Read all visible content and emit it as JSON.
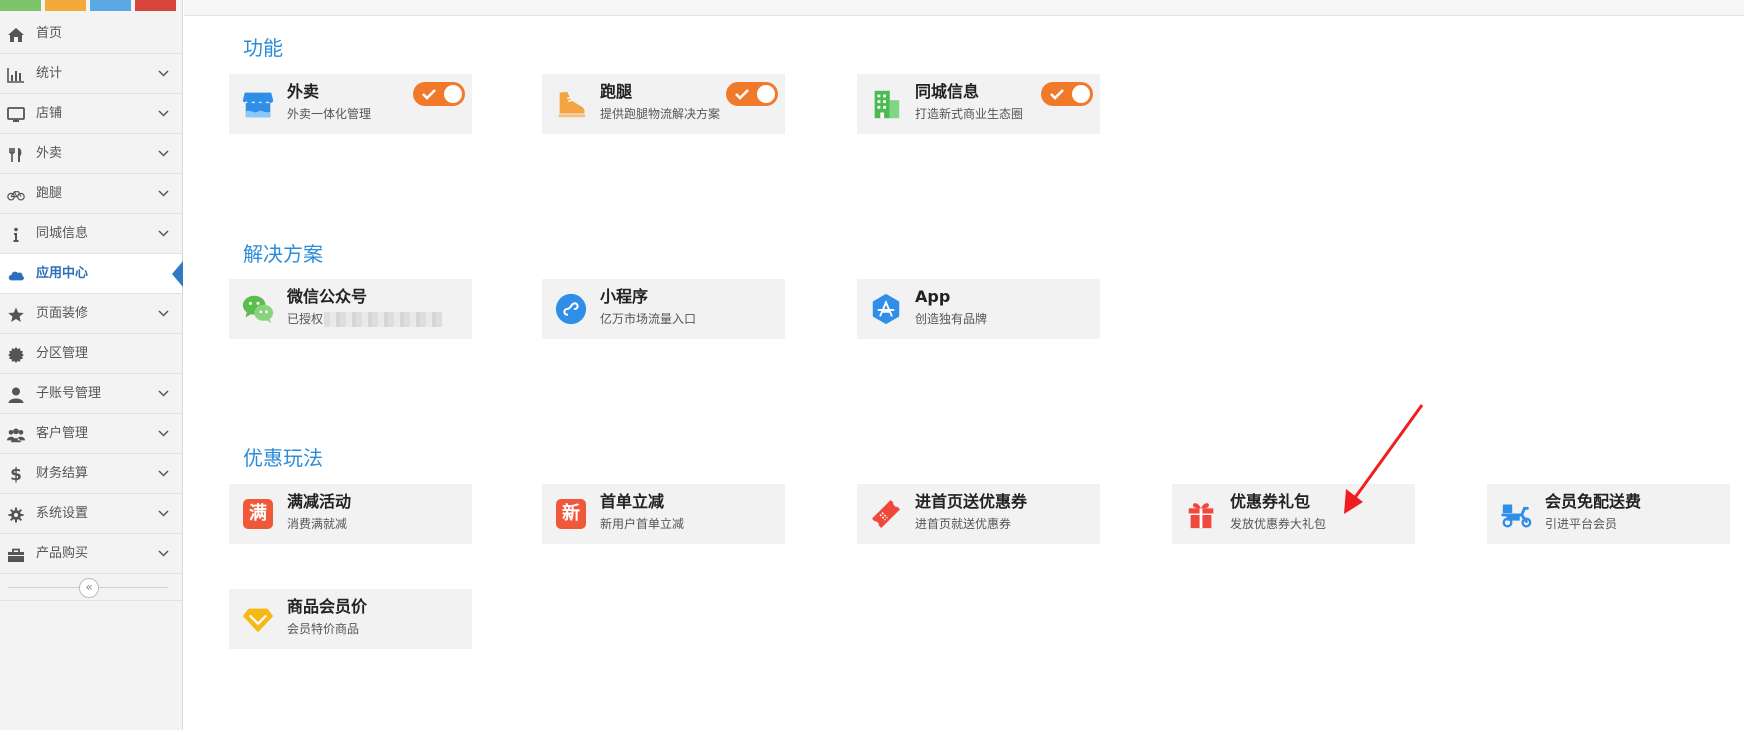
{
  "sidebar": {
    "items": [
      {
        "name": "sidebar-item-home",
        "label": "首页",
        "icon": "home-icon",
        "has_children": false
      },
      {
        "name": "sidebar-item-stats",
        "label": "统计",
        "icon": "bar-chart-icon",
        "has_children": true
      },
      {
        "name": "sidebar-item-store",
        "label": "店铺",
        "icon": "monitor-icon",
        "has_children": true
      },
      {
        "name": "sidebar-item-takeout",
        "label": "外卖",
        "icon": "fork-knife-icon",
        "has_children": true
      },
      {
        "name": "sidebar-item-errand",
        "label": "跑腿",
        "icon": "bicycle-icon",
        "has_children": true
      },
      {
        "name": "sidebar-item-city-info",
        "label": "同城信息",
        "icon": "info-icon",
        "has_children": true
      },
      {
        "name": "sidebar-item-app-center",
        "label": "应用中心",
        "icon": "cloud-icon",
        "has_children": false,
        "active": true
      },
      {
        "name": "sidebar-item-page-decor",
        "label": "页面装修",
        "icon": "star-icon",
        "has_children": true
      },
      {
        "name": "sidebar-item-zone",
        "label": "分区管理",
        "icon": "badge-icon",
        "has_children": false
      },
      {
        "name": "sidebar-item-subaccount",
        "label": "子账号管理",
        "icon": "user-icon",
        "has_children": true
      },
      {
        "name": "sidebar-item-customer",
        "label": "客户管理",
        "icon": "users-icon",
        "has_children": true
      },
      {
        "name": "sidebar-item-finance",
        "label": "财务结算",
        "icon": "dollar-icon",
        "has_children": true
      },
      {
        "name": "sidebar-item-settings",
        "label": "系统设置",
        "icon": "gear-icon",
        "has_children": true
      },
      {
        "name": "sidebar-item-purchase",
        "label": "产品购买",
        "icon": "shopping-bag-icon",
        "has_children": true
      }
    ],
    "collapse_symbol": "«",
    "shortcut_colors": [
      "#7cc36a",
      "#f4a93b",
      "#5aa9e6",
      "#d6443a"
    ]
  },
  "sections": {
    "features": {
      "title": "功能",
      "cards": [
        {
          "title": "外卖",
          "subtitle": "外卖一体化管理",
          "icon": "storefront-icon",
          "toggle_on": true
        },
        {
          "title": "跑腿",
          "subtitle": "提供跑腿物流解决方案",
          "icon": "shoe-icon",
          "toggle_on": true
        },
        {
          "title": "同城信息",
          "subtitle": "打造新式商业生态圈",
          "icon": "building-icon",
          "toggle_on": true
        }
      ]
    },
    "solutions": {
      "title": "解决方案",
      "cards": [
        {
          "title": "微信公众号",
          "subtitle": "已授权",
          "icon": "wechat-icon"
        },
        {
          "title": "小程序",
          "subtitle": "亿万市场流量入口",
          "icon": "mini-program-icon"
        },
        {
          "title": "App",
          "subtitle": "创造独有品牌",
          "icon": "app-store-icon"
        }
      ]
    },
    "promotions": {
      "title": "优惠玩法",
      "cards": [
        {
          "title": "满减活动",
          "subtitle": "消费满就减",
          "icon": "full-reduction-icon",
          "glyph": "满"
        },
        {
          "title": "首单立减",
          "subtitle": "新用户首单立减",
          "icon": "new-user-icon",
          "glyph": "新"
        },
        {
          "title": "进首页送优惠券",
          "subtitle": "进首页就送优惠券",
          "icon": "coupon-ticket-icon"
        },
        {
          "title": "优惠券礼包",
          "subtitle": "发放优惠券大礼包",
          "icon": "gift-icon"
        },
        {
          "title": "会员免配送费",
          "subtitle": "引进平台会员",
          "icon": "scooter-icon"
        },
        {
          "title": "商品会员价",
          "subtitle": "会员特价商品",
          "icon": "diamond-icon"
        }
      ]
    }
  },
  "colors": {
    "accent_blue": "#2d8cd8",
    "toggle_orange": "#f07a2a",
    "arrow_red": "#f01e1e",
    "active_text": "#2d6fb8"
  }
}
